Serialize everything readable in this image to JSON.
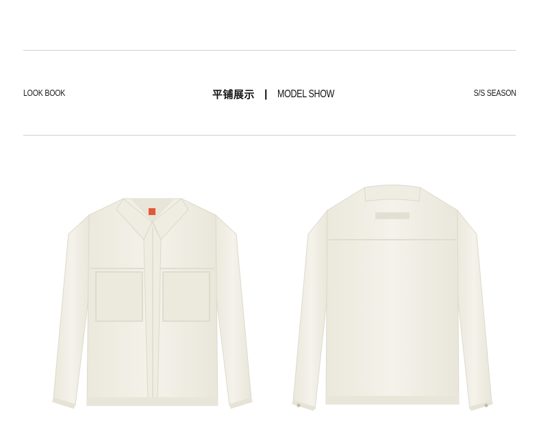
{
  "header": {
    "left_label": "LOOK BOOK",
    "center_title_cn": "平铺展示",
    "center_separator": "|",
    "center_title_en": "MODEL SHOW",
    "right_label": "S/S SEASON"
  },
  "images": [
    {
      "name": "front-view",
      "colors": {
        "fabric": "#f2f0e6",
        "shade": "#e2dfd2",
        "label": "#e05a3a"
      }
    },
    {
      "name": "back-view",
      "colors": {
        "fabric": "#f2f0e6",
        "shade": "#e2dfd2"
      }
    }
  ]
}
